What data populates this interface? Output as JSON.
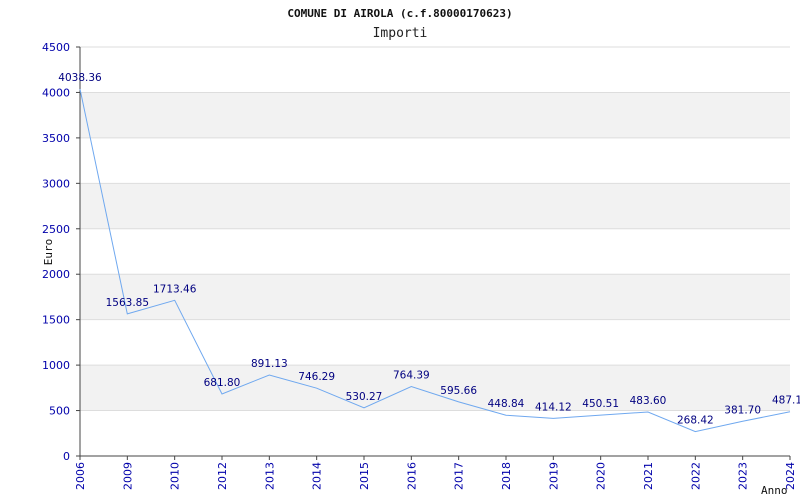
{
  "chart_data": {
    "type": "line",
    "title": "COMUNE DI AIROLA (c.f.80000170623)",
    "subtitle": "Importi",
    "xlabel": "Anno",
    "ylabel": "Euro",
    "ylim": [
      0,
      4500
    ],
    "yticks": [
      "0",
      "500",
      "1000",
      "1500",
      "2000",
      "2500",
      "3000",
      "3500",
      "4000",
      "4500"
    ],
    "grid": true,
    "colors": {
      "line": "#6fa8ef",
      "band": "#f2f2f2",
      "gridline": "#dddddd",
      "tick_text": "#0000aa",
      "label_text": "#000080"
    },
    "categories": [
      "2006",
      "2009",
      "2010",
      "2012",
      "2013",
      "2014",
      "2015",
      "2016",
      "2017",
      "2018",
      "2019",
      "2020",
      "2021",
      "2022",
      "2023",
      "2024"
    ],
    "series": [
      {
        "values": [
          4038.36,
          1563.85,
          1713.46,
          681.8,
          891.13,
          746.29,
          530.27,
          764.39,
          595.66,
          448.84,
          414.12,
          450.51,
          483.6,
          268.42,
          381.7,
          487.1
        ],
        "labels": [
          "4038.36",
          "1563.85",
          "1713.46",
          "681.80",
          "891.13",
          "746.29",
          "530.27",
          "764.39",
          "595.66",
          "448.84",
          "414.12",
          "450.51",
          "483.60",
          "268.42",
          "381.70",
          "487.1"
        ]
      }
    ]
  }
}
